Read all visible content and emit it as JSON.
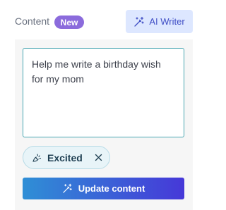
{
  "header": {
    "content_label": "Content",
    "badge_label": "New",
    "ai_writer_label": "AI Writer",
    "ai_writer_icon": "magic-wand-icon"
  },
  "editor": {
    "prompt_text": "Help me write a birthday wish for my mom"
  },
  "tone_chip": {
    "label": "Excited",
    "icon": "celebration-icon",
    "remove_icon": "close-icon"
  },
  "actions": {
    "update_label": "Update content",
    "update_icon": "magic-wand-icon"
  },
  "colors": {
    "badge": "#8b6bdc",
    "ai_writer_bg": "#dde7ff",
    "ai_writer_text": "#3f4ec5",
    "focus_border": "#4aa7b2",
    "chip_bg": "#e8f4f8",
    "gradient_start": "#2f8fd6",
    "gradient_end": "#4638d8"
  }
}
